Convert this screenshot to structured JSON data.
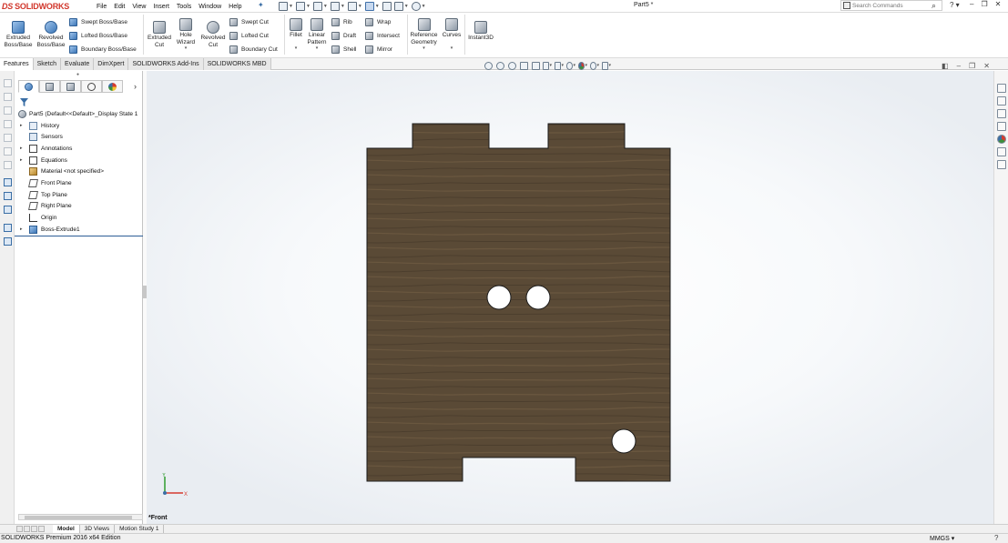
{
  "app": {
    "brand_prefix": "DS",
    "brand": "SOLIDWORKS",
    "document_title": "Part5 *",
    "search_placeholder": "Search Commands",
    "help_symbol": "?"
  },
  "menu": [
    "File",
    "Edit",
    "View",
    "Insert",
    "Tools",
    "Window",
    "Help"
  ],
  "quick_access": [
    "new-icon",
    "open-icon",
    "save-icon",
    "print-icon",
    "undo-icon",
    "select-icon",
    "rebuild-icon",
    "file-properties-icon",
    "options-icon"
  ],
  "ribbon": {
    "extruded_boss": "Extruded Boss/Base",
    "revolved_boss": "Revolved Boss/Base",
    "swept_boss": "Swept Boss/Base",
    "lofted_boss": "Lofted Boss/Base",
    "boundary_boss": "Boundary Boss/Base",
    "extruded_cut": "Extruded Cut",
    "hole_wizard": "Hole Wizard",
    "revolved_cut": "Revolved Cut",
    "swept_cut": "Swept Cut",
    "lofted_cut": "Lofted Cut",
    "boundary_cut": "Boundary Cut",
    "fillet": "Fillet",
    "linear_pattern": "Linear Pattern",
    "rib": "Rib",
    "draft": "Draft",
    "shell": "Shell",
    "wrap": "Wrap",
    "intersect": "Intersect",
    "mirror": "Mirror",
    "reference_geometry": "Reference Geometry",
    "curves": "Curves",
    "instant3d": "Instant3D"
  },
  "command_tabs": [
    "Features",
    "Sketch",
    "Evaluate",
    "DimXpert",
    "SOLIDWORKS Add-Ins",
    "SOLIDWORKS MBD"
  ],
  "active_command_tab": "Features",
  "feature_tree": {
    "root": "Part5  (Default<<Default>_Display State 1",
    "items": [
      {
        "label": "History",
        "icon": "history-folder-icon",
        "expandable": true
      },
      {
        "label": "Sensors",
        "icon": "sensors-icon",
        "expandable": false
      },
      {
        "label": "Annotations",
        "icon": "annotations-icon",
        "expandable": true
      },
      {
        "label": "Equations",
        "icon": "equations-icon",
        "expandable": true
      },
      {
        "label": "Material <not specified>",
        "icon": "material-icon",
        "expandable": false
      },
      {
        "label": "Front Plane",
        "icon": "plane-icon",
        "expandable": false
      },
      {
        "label": "Top Plane",
        "icon": "plane-icon",
        "expandable": false
      },
      {
        "label": "Right Plane",
        "icon": "plane-icon",
        "expandable": false
      },
      {
        "label": "Origin",
        "icon": "origin-icon",
        "expandable": false
      },
      {
        "label": "Boss-Extrude1",
        "icon": "boss-extrude-icon",
        "expandable": true
      }
    ]
  },
  "viewport": {
    "view_name": "*Front",
    "triad_labels": {
      "x": "X",
      "y": "Y"
    },
    "part_color": "#5a4a36",
    "hole_color": "#ffffff"
  },
  "bottom_tabs": [
    "Model",
    "3D Views",
    "Motion Study 1"
  ],
  "active_bottom_tab": "Model",
  "status": {
    "edition": "SOLIDWORKS Premium 2016 x64 Edition",
    "units": "MMGS",
    "units_dropdown": "▾"
  }
}
